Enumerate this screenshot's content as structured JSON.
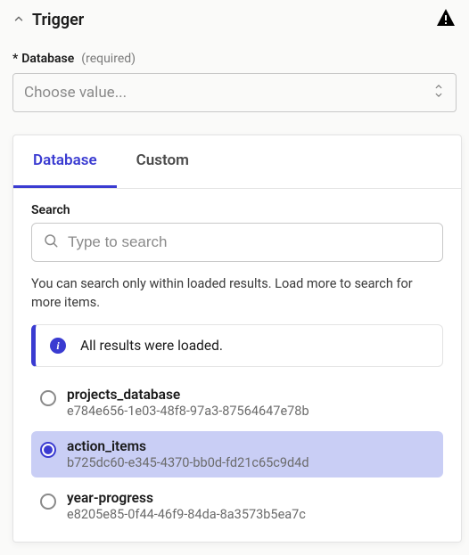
{
  "header": {
    "title": "Trigger"
  },
  "field": {
    "asterisk": "*",
    "label": "Database",
    "required": "(required)",
    "placeholder": "Choose value..."
  },
  "tabs": {
    "database": "Database",
    "custom": "Custom"
  },
  "search": {
    "label": "Search",
    "placeholder": "Type to search"
  },
  "helper": "You can search only within loaded results. Load more to search for more items.",
  "info": {
    "icon": "i",
    "text": "All results were loaded."
  },
  "options": [
    {
      "name": "projects_database",
      "id": "e784e656-1e03-48f8-97a3-87564647e78b",
      "selected": false
    },
    {
      "name": "action_items",
      "id": "b725dc60-e345-4370-bb0d-fd21c65c9d4d",
      "selected": true
    },
    {
      "name": "year-progress",
      "id": "e8205e85-0f44-46f9-84da-8a3573b5ea7c",
      "selected": false
    }
  ]
}
